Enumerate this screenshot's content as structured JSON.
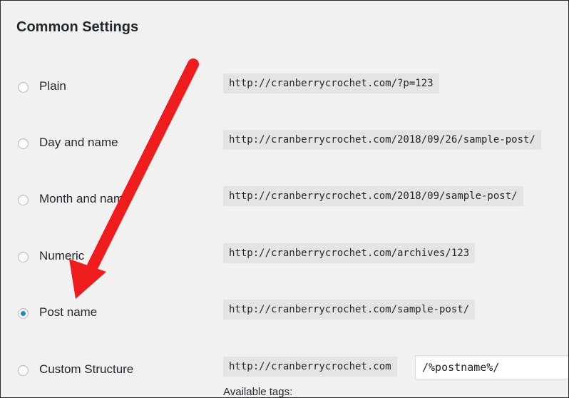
{
  "section": {
    "title": "Common Settings"
  },
  "options": [
    {
      "label": "Plain",
      "url": "http://cranberrycrochet.com/?p=123",
      "checked": false
    },
    {
      "label": "Day and name",
      "url": "http://cranberrycrochet.com/2018/09/26/sample-post/",
      "checked": false
    },
    {
      "label": "Month and name",
      "url": "http://cranberrycrochet.com/2018/09/sample-post/",
      "checked": false
    },
    {
      "label": "Numeric",
      "url": "http://cranberrycrochet.com/archives/123",
      "checked": false
    },
    {
      "label": "Post name",
      "url": "http://cranberrycrochet.com/sample-post/",
      "checked": true
    },
    {
      "label": "Custom Structure",
      "url": "http://cranberrycrochet.com",
      "checked": false
    }
  ],
  "custom": {
    "value": "/%postname%/"
  },
  "tags": {
    "label": "Available tags:"
  },
  "annotation": {
    "arrow_color": "#ee1c1c",
    "icon": "red-arrow-icon"
  }
}
